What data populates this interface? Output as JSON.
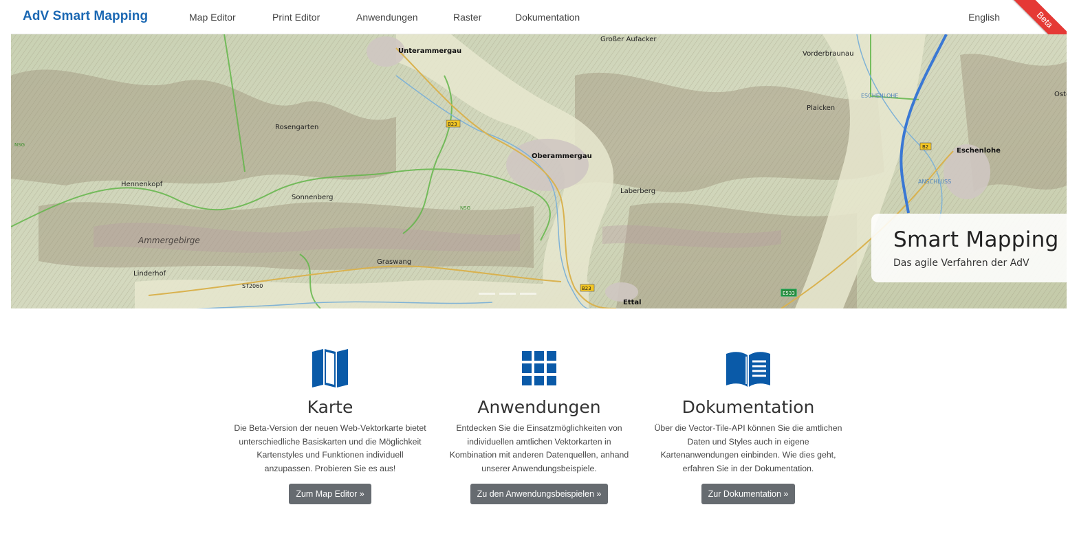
{
  "navbar": {
    "brand": "AdV Smart Mapping",
    "links": [
      "Map Editor",
      "Print Editor",
      "Anwendungen",
      "Raster",
      "Dokumentation"
    ],
    "language": "English",
    "badge": "Beta"
  },
  "hero": {
    "title": "Smart Mapping",
    "subtitle": "Das agile Verfahren der AdV",
    "map_labels": {
      "unterammergau": "Unterammergau",
      "grosser_aufacker": "Großer Aufacker",
      "vorderbraunau": "Vorderbraunau",
      "eschenlohe_river": "ESCHENLOHE",
      "plaicken": "Plaicken",
      "eschenlohe": "Eschenlohe",
      "rosengarten": "Rosengarten",
      "oberammergau": "Oberammergau",
      "hennenkopf": "Hennenkopf",
      "sonnenberg": "Sonnenberg",
      "laberberg": "Laberberg",
      "ammergebirge": "Ammergebirge",
      "graswang": "Graswang",
      "linderhof": "Linderhof",
      "st2060": "ST2060",
      "ettal": "Ettal",
      "anschluss": "ANSCHLUSS",
      "b23": "B23",
      "b2": "B2",
      "e533": "E533",
      "nsg": "NSG",
      "oste": "Oste"
    }
  },
  "features": [
    {
      "icon": "map-icon",
      "title": "Karte",
      "text": "Die Beta-Version der neuen Web-Vektorkarte bietet unterschiedliche Basiskarten und die Möglichkeit Kartenstyles und Funktionen individuell anzupassen. Probieren Sie es aus!",
      "button": "Zum Map Editor »"
    },
    {
      "icon": "grid-icon",
      "title": "Anwendungen",
      "text": "Entdecken Sie die Einsatzmöglichkeiten von individuellen amtlichen Vektorkarten in Kombination mit anderen Datenquellen, anhand unserer Anwendungsbeispiele.",
      "button": "Zu den Anwendungsbeispielen »"
    },
    {
      "icon": "book-icon",
      "title": "Dokumentation",
      "text": "Über die Vector-Tile-API können Sie die amtlichen Daten und Styles auch in eigene Kartenanwendungen einbinden. Wie dies geht, erfahren Sie in der Dokumentation.",
      "button": "Zur Dokumentation »"
    }
  ],
  "colors": {
    "brand": "#1b68b3",
    "icon": "#0a5aa8",
    "button": "#666b70",
    "beta": "#e53935"
  }
}
